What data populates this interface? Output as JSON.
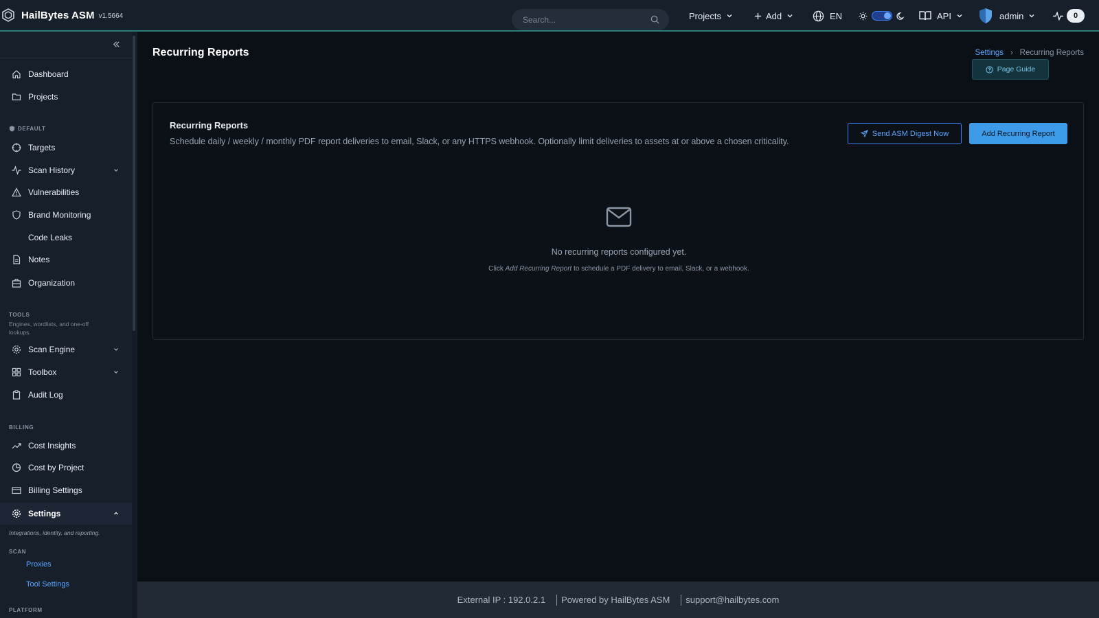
{
  "app": {
    "name": "HailBytes ASM",
    "version": "v1.5664"
  },
  "topbar": {
    "search_placeholder": "Search...",
    "projects_label": "Projects",
    "add_label": "Add",
    "language": "EN",
    "api_label": "API",
    "user_name": "admin",
    "notification_count": "0"
  },
  "sidebar": {
    "items_top": [
      {
        "label": "Dashboard",
        "icon": "home-icon"
      },
      {
        "label": "Projects",
        "icon": "folder-icon"
      }
    ],
    "section_default": "DEFAULT",
    "items_default": [
      {
        "label": "Targets",
        "icon": "target-icon"
      },
      {
        "label": "Scan History",
        "icon": "activity-icon"
      },
      {
        "label": "Vulnerabilities",
        "icon": "warning-icon"
      },
      {
        "label": "Brand Monitoring",
        "icon": "shield-icon"
      },
      {
        "label": "Code Leaks",
        "icon": ""
      },
      {
        "label": "Notes",
        "icon": "file-icon"
      },
      {
        "label": "Organization",
        "icon": "building-icon"
      }
    ],
    "section_tools": "TOOLS",
    "section_tools_desc": "Engines, wordlists, and one-off lookups.",
    "items_tools": [
      {
        "label": "Scan Engine",
        "icon": "gear-cog-icon"
      },
      {
        "label": "Toolbox",
        "icon": "grid-icon"
      },
      {
        "label": "Audit Log",
        "icon": "clipboard-icon"
      }
    ],
    "section_billing": "BILLING",
    "items_billing": [
      {
        "label": "Cost Insights",
        "icon": "trending-up-icon"
      },
      {
        "label": "Cost by Project",
        "icon": "pie-chart-icon"
      },
      {
        "label": "Billing Settings",
        "icon": "credit-card-icon"
      }
    ],
    "settings_label": "Settings",
    "settings_desc": "Integrations, identity, and reporting.",
    "section_scan": "SCAN",
    "scan_items": [
      "Proxies",
      "Tool Settings"
    ],
    "section_platform": "PLATFORM"
  },
  "page": {
    "title": "Recurring Reports",
    "breadcrumb": {
      "parent": "Settings",
      "current": "Recurring Reports"
    },
    "page_guide_label": "Page Guide"
  },
  "card": {
    "title": "Recurring Reports",
    "description": "Schedule daily / weekly / monthly PDF report deliveries to email, Slack, or any HTTPS webhook. Optionally limit deliveries to assets at or above a chosen criticality.",
    "send_digest_label": "Send ASM Digest Now",
    "add_report_label": "Add Recurring Report",
    "empty_title": "No recurring reports configured yet.",
    "empty_hint_prefix": "Click",
    "empty_hint_emphasis": "Add Recurring Report",
    "empty_hint_suffix": "to schedule a PDF delivery to email, Slack, or a webhook."
  },
  "footer": {
    "external_ip": "External IP : 192.0.2.1",
    "powered_by": "Powered by HailBytes ASM",
    "support_email": "support@hailbytes.com"
  },
  "colors": {
    "accent": "#3d9be9",
    "link": "#58a6ff",
    "topbar_border": "#2e7d7a",
    "background": "#0b1017",
    "sidebar": "#171f2b"
  }
}
